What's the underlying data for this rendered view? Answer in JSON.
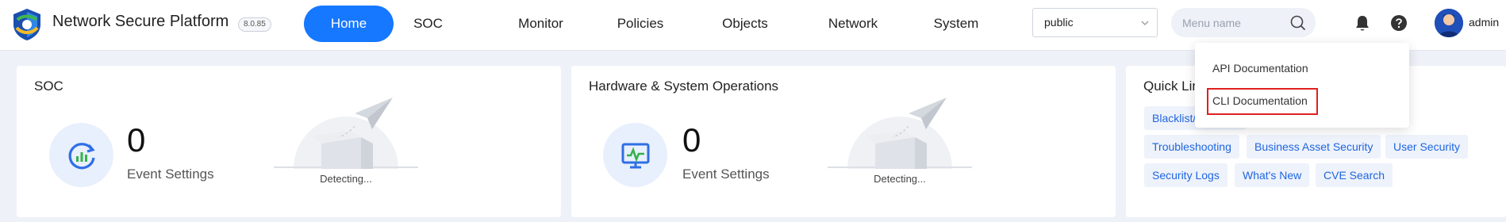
{
  "header": {
    "title": "Network Secure Platform",
    "version": "8.0.85",
    "logo_icon": "shield-logo-icon"
  },
  "nav": {
    "items": [
      {
        "label": "Home",
        "active": true
      },
      {
        "label": "SOC",
        "active": false
      },
      {
        "label": "Monitor",
        "active": false
      },
      {
        "label": "Policies",
        "active": false
      },
      {
        "label": "Objects",
        "active": false
      },
      {
        "label": "Network",
        "active": false
      },
      {
        "label": "System",
        "active": false
      }
    ]
  },
  "toolbar": {
    "select_value": "public",
    "search_placeholder": "Menu name",
    "user_name": "admin"
  },
  "soc_card": {
    "title": "SOC",
    "count": "0",
    "label": "Event Settings",
    "status": "Detecting..."
  },
  "hw_card": {
    "title": "Hardware & System Operations",
    "count": "0",
    "label": "Event Settings",
    "status": "Detecting..."
  },
  "quick_links": {
    "title": "Quick Links",
    "items": [
      "Blacklist/Whitelist",
      "Troubleshooting",
      "Business Asset Security",
      "User Security",
      "Security Logs",
      "What's New",
      "CVE Search"
    ]
  },
  "help_menu": {
    "items": [
      "API Documentation",
      "CLI Documentation"
    ],
    "highlighted_item": "CLI Documentation",
    "highlight_color": "#e02020"
  },
  "colors": {
    "accent": "#1677ff",
    "link": "#1f66e0",
    "page_bg": "#eef1f8"
  }
}
